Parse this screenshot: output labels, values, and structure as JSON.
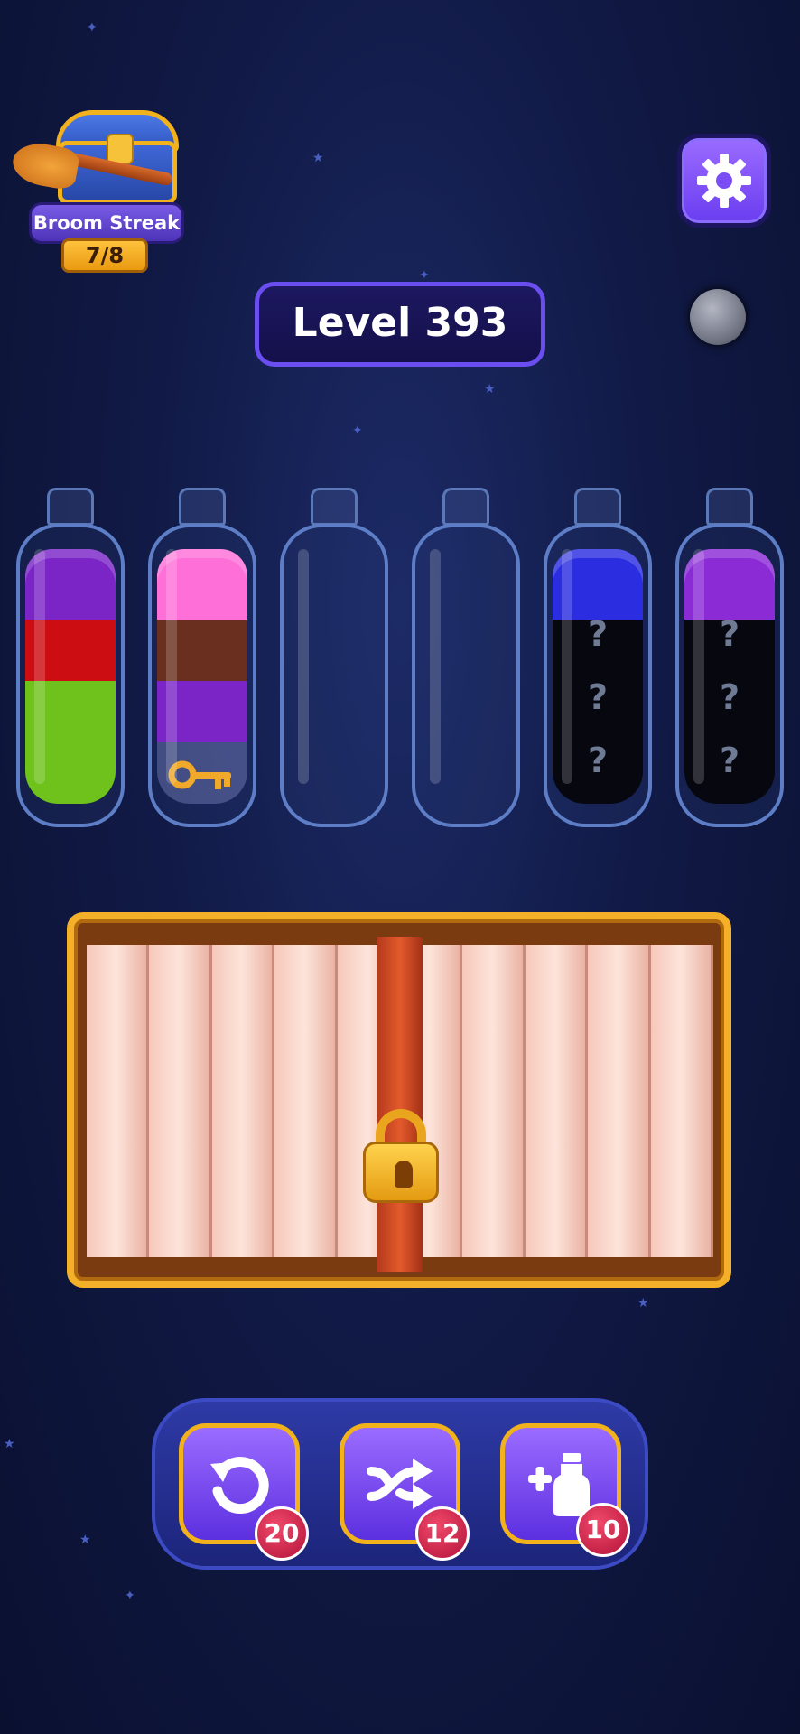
{
  "streak": {
    "label": "Broom Streak",
    "count": "7/8"
  },
  "level": {
    "label": "Level 393"
  },
  "bottles": [
    {
      "layers": [
        "#7b25c7",
        "#cc0d12",
        "#6ec21b",
        "#6ec21b"
      ],
      "question_marks": 0,
      "has_key": false
    },
    {
      "layers": [
        "#ff6fd8",
        "#6a2f1f",
        "#7b25c7",
        "empty"
      ],
      "question_marks": 0,
      "has_key": true
    },
    {
      "layers": [],
      "question_marks": 0,
      "has_key": false
    },
    {
      "layers": [],
      "question_marks": 0,
      "has_key": false
    },
    {
      "layers": [
        "#2a2ee0",
        "hidden",
        "hidden",
        "hidden"
      ],
      "question_marks": 3,
      "has_key": false
    },
    {
      "layers": [
        "#8a2bd6",
        "hidden",
        "hidden",
        "hidden"
      ],
      "question_marks": 3,
      "has_key": false
    }
  ],
  "hidden_symbol": "?",
  "tools": [
    {
      "name": "undo",
      "icon": "undo-icon",
      "count": "20"
    },
    {
      "name": "shuffle",
      "icon": "shuffle-icon",
      "count": "12"
    },
    {
      "name": "add-bottle",
      "icon": "add-bottle-icon",
      "count": "10"
    }
  ],
  "colors": {
    "accent": "#7b4dff",
    "gold": "#f2b21c",
    "badge": "#d01a45"
  }
}
